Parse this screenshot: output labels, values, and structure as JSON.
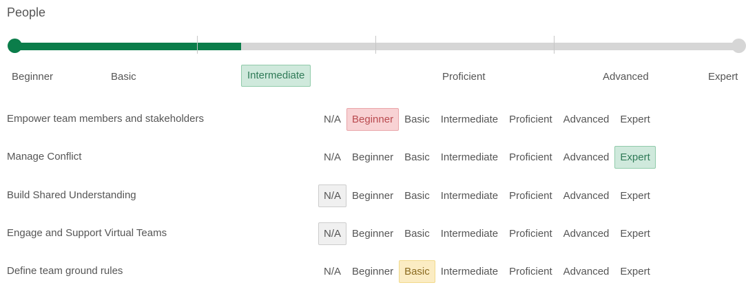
{
  "section": {
    "title": "People"
  },
  "progress": {
    "current_level": "Intermediate",
    "levels": [
      "Beginner",
      "Basic",
      "Intermediate",
      "Proficient",
      "Advanced",
      "Expert"
    ]
  },
  "options": [
    "N/A",
    "Beginner",
    "Basic",
    "Intermediate",
    "Proficient",
    "Advanced",
    "Expert"
  ],
  "rows": [
    {
      "label": "Empower team members and stakeholders",
      "selected": "Beginner"
    },
    {
      "label": "Manage Conflict",
      "selected": "Expert"
    },
    {
      "label": "Build Shared Understanding",
      "selected": "N/A"
    },
    {
      "label": "Engage and Support Virtual Teams",
      "selected": "N/A"
    },
    {
      "label": "Define team ground rules",
      "selected": "Basic"
    }
  ],
  "colors": {
    "progress_fill": "#0b7d4a",
    "track": "#d6d6d6",
    "selected_red": "#f8d2d4",
    "selected_green": "#cfe9dc",
    "selected_gray": "#f0f0f0",
    "selected_yellow": "#fbecc3"
  }
}
